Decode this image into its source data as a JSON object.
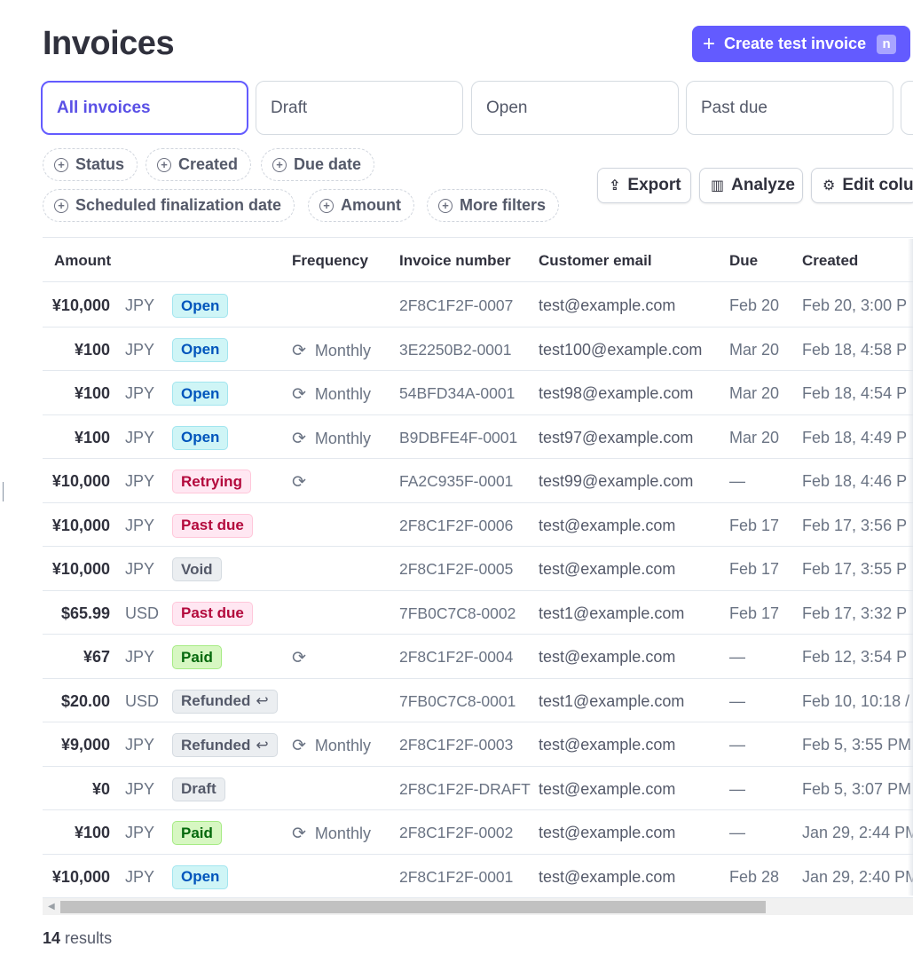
{
  "page": {
    "title": "Invoices"
  },
  "header": {
    "create_label": "Create test invoice",
    "create_shortcut": "n"
  },
  "status_tabs": [
    {
      "label": "All invoices",
      "active": true
    },
    {
      "label": "Draft",
      "active": false
    },
    {
      "label": "Open",
      "active": false
    },
    {
      "label": "Past due",
      "active": false
    }
  ],
  "filters": [
    "Status",
    "Created",
    "Due date",
    "Scheduled finalization date",
    "Amount",
    "More filters"
  ],
  "actions": {
    "export": "Export",
    "analyze": "Analyze",
    "edit_columns": "Edit colu"
  },
  "table": {
    "columns": {
      "amount": "Amount",
      "frequency": "Frequency",
      "invoice_number": "Invoice number",
      "customer_email": "Customer email",
      "due": "Due",
      "created": "Created"
    },
    "rows": [
      {
        "amount": "¥10,000",
        "currency": "JPY",
        "status": "Open",
        "status_kind": "open",
        "recurring": false,
        "frequency": "",
        "invoice": "2F8C1F2F-0007",
        "email": "test@example.com",
        "due": "Feb 20",
        "created": "Feb 20, 3:00 P"
      },
      {
        "amount": "¥100",
        "currency": "JPY",
        "status": "Open",
        "status_kind": "open",
        "recurring": true,
        "frequency": "Monthly",
        "invoice": "3E2250B2-0001",
        "email": "test100@example.com",
        "due": "Mar 20",
        "created": "Feb 18, 4:58 P"
      },
      {
        "amount": "¥100",
        "currency": "JPY",
        "status": "Open",
        "status_kind": "open",
        "recurring": true,
        "frequency": "Monthly",
        "invoice": "54BFD34A-0001",
        "email": "test98@example.com",
        "due": "Mar 20",
        "created": "Feb 18, 4:54 P"
      },
      {
        "amount": "¥100",
        "currency": "JPY",
        "status": "Open",
        "status_kind": "open",
        "recurring": true,
        "frequency": "Monthly",
        "invoice": "B9DBFE4F-0001",
        "email": "test97@example.com",
        "due": "Mar 20",
        "created": "Feb 18, 4:49 P"
      },
      {
        "amount": "¥10,000",
        "currency": "JPY",
        "status": "Retrying",
        "status_kind": "retrying",
        "recurring": true,
        "frequency": "",
        "invoice": "FA2C935F-0001",
        "email": "test99@example.com",
        "due": "—",
        "created": "Feb 18, 4:46 P"
      },
      {
        "amount": "¥10,000",
        "currency": "JPY",
        "status": "Past due",
        "status_kind": "pastdue",
        "recurring": false,
        "frequency": "",
        "invoice": "2F8C1F2F-0006",
        "email": "test@example.com",
        "due": "Feb 17",
        "created": "Feb 17, 3:56 P"
      },
      {
        "amount": "¥10,000",
        "currency": "JPY",
        "status": "Void",
        "status_kind": "void",
        "recurring": false,
        "frequency": "",
        "invoice": "2F8C1F2F-0005",
        "email": "test@example.com",
        "due": "Feb 17",
        "created": "Feb 17, 3:55 P"
      },
      {
        "amount": "$65.99",
        "currency": "USD",
        "status": "Past due",
        "status_kind": "pastdue",
        "recurring": false,
        "frequency": "",
        "invoice": "7FB0C7C8-0002",
        "email": "test1@example.com",
        "due": "Feb 17",
        "created": "Feb 17, 3:32 P"
      },
      {
        "amount": "¥67",
        "currency": "JPY",
        "status": "Paid",
        "status_kind": "paid",
        "recurring": true,
        "frequency": "",
        "invoice": "2F8C1F2F-0004",
        "email": "test@example.com",
        "due": "—",
        "created": "Feb 12, 3:54 P"
      },
      {
        "amount": "$20.00",
        "currency": "USD",
        "status": "Refunded",
        "status_kind": "refunded",
        "recurring": false,
        "frequency": "",
        "invoice": "7FB0C7C8-0001",
        "email": "test1@example.com",
        "due": "—",
        "created": "Feb 10, 10:18 /"
      },
      {
        "amount": "¥9,000",
        "currency": "JPY",
        "status": "Refunded",
        "status_kind": "refunded",
        "recurring": true,
        "frequency": "Monthly",
        "invoice": "2F8C1F2F-0003",
        "email": "test@example.com",
        "due": "—",
        "created": "Feb 5, 3:55 PM"
      },
      {
        "amount": "¥0",
        "currency": "JPY",
        "status": "Draft",
        "status_kind": "draft",
        "recurring": false,
        "frequency": "",
        "invoice": "2F8C1F2F-DRAFT",
        "email": "test@example.com",
        "due": "—",
        "created": "Feb 5, 3:07 PM"
      },
      {
        "amount": "¥100",
        "currency": "JPY",
        "status": "Paid",
        "status_kind": "paid",
        "recurring": true,
        "frequency": "Monthly",
        "invoice": "2F8C1F2F-0002",
        "email": "test@example.com",
        "due": "—",
        "created": "Jan 29, 2:44 PM"
      },
      {
        "amount": "¥10,000",
        "currency": "JPY",
        "status": "Open",
        "status_kind": "open",
        "recurring": false,
        "frequency": "",
        "invoice": "2F8C1F2F-0001",
        "email": "test@example.com",
        "due": "Feb 28",
        "created": "Jan 29, 2:40 PM"
      }
    ]
  },
  "footer": {
    "count": "14",
    "results_label": "results"
  },
  "colors": {
    "accent": "#635bff",
    "open": "#0055bc",
    "danger": "#b3093c",
    "success": "#05690d",
    "neutral": "#545969"
  },
  "icons": {
    "create": "plus-icon",
    "filter": "plus-circle-icon",
    "export": "export-icon",
    "analyze": "bar-chart-icon",
    "edit_columns": "gear-icon",
    "recurring": "refresh-icon",
    "refunded": "undo-arrow-icon"
  }
}
